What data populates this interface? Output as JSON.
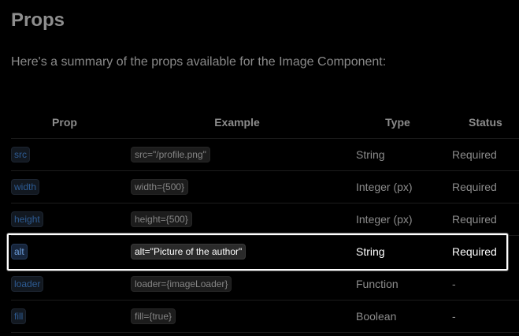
{
  "page": {
    "title": "Props",
    "intro": "Here's a summary of the props available for the Image Component:"
  },
  "table": {
    "headers": {
      "prop": "Prop",
      "example": "Example",
      "type": "Type",
      "status": "Status"
    },
    "rows": [
      {
        "prop": "src",
        "example": "src=\"/profile.png\"",
        "type": "String",
        "status": "Required"
      },
      {
        "prop": "width",
        "example": "width={500}",
        "type": "Integer (px)",
        "status": "Required"
      },
      {
        "prop": "height",
        "example": "height={500}",
        "type": "Integer (px)",
        "status": "Required"
      },
      {
        "prop": "alt",
        "example": "alt=\"Picture of the author\"",
        "type": "String",
        "status": "Required"
      },
      {
        "prop": "loader",
        "example": "loader={imageLoader}",
        "type": "Function",
        "status": "-"
      },
      {
        "prop": "fill",
        "example": "fill={true}",
        "type": "Boolean",
        "status": "-"
      }
    ],
    "highlighted_row": "alt"
  },
  "colors": {
    "background": "#000000",
    "text": "#8f8f8f",
    "prop_chip_text": "#2d5b93",
    "highlight_border": "#ffffff"
  }
}
